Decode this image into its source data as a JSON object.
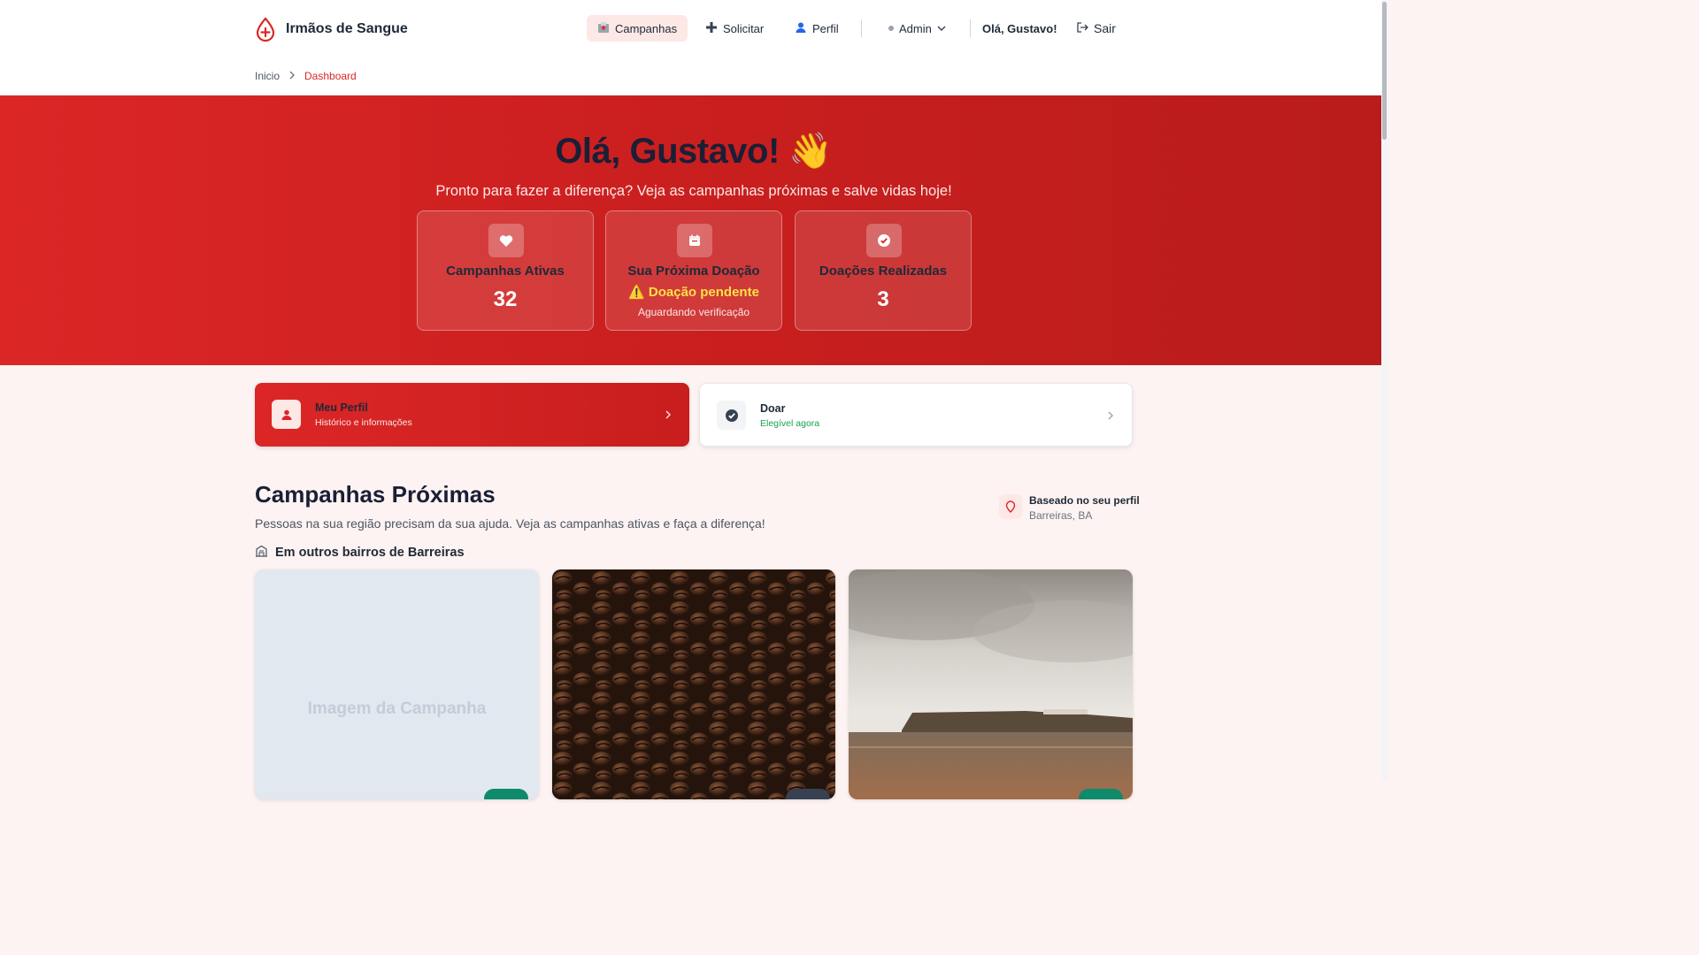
{
  "header": {
    "brand": "Irmãos de Sangue",
    "nav": {
      "campaigns": "Campanhas",
      "request": "Solicitar",
      "profile": "Perfil",
      "admin": "Admin",
      "greeting": "Olá, Gustavo!",
      "logout": "Sair"
    },
    "breadcrumb": {
      "home": "Inicio",
      "current": "Dashboard"
    }
  },
  "hero": {
    "title": "Olá, Gustavo! 👋",
    "subtitle": "Pronto para fazer a diferença? Veja as campanhas próximas e salve vidas hoje!",
    "stats": [
      {
        "label": "Campanhas Ativas",
        "value": "32",
        "icon": "heart-icon"
      },
      {
        "label": "Sua Próxima Doação",
        "status": "⚠️ Doação pendente",
        "note": "Aguardando verificação",
        "icon": "calendar-icon"
      },
      {
        "label": "Doações Realizadas",
        "value": "3",
        "icon": "check-circle-icon"
      }
    ]
  },
  "actions": [
    {
      "title": "Meu Perfil",
      "subtitle": "Histórico e informações",
      "icon": "user-icon"
    },
    {
      "title": "Doar",
      "subtitle": "Elegível agora",
      "icon": "check-circle-icon"
    }
  ],
  "section": {
    "title": "Campanhas Próximas",
    "subtitle": "Pessoas na sua região precisam da sua ajuda. Veja as campanhas ativas e faça a diferença!",
    "location_title": "Baseado no seu perfil",
    "location_place": "Barreiras, BA",
    "group_title": "Em outros bairros de Barreiras"
  },
  "campaigns": [
    {
      "image_placeholder": "Imagem da Campanha"
    },
    {
      "image": "coffee-beans-photo"
    },
    {
      "image": "coastline-photo"
    }
  ],
  "colors": {
    "primary": "#dc2626",
    "success": "#16a34a",
    "warning": "#fde047"
  }
}
